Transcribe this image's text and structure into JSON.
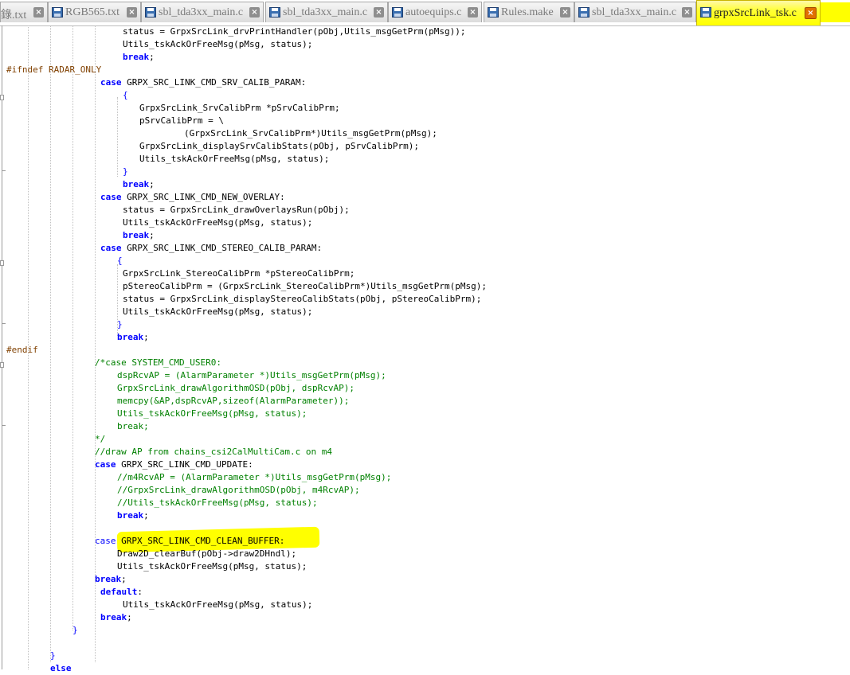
{
  "tabs": [
    {
      "label": "錄.txt",
      "icon": "",
      "active": false
    },
    {
      "label": "RGB565.txt",
      "icon": "floppy-disk-icon",
      "active": false
    },
    {
      "label": "sbl_tda3xx_main.c",
      "icon": "floppy-disk-icon",
      "active": false
    },
    {
      "label": "sbl_tda3xx_main.c",
      "icon": "floppy-disk-icon",
      "active": false
    },
    {
      "label": "autoequips.c",
      "icon": "floppy-disk-icon",
      "active": false
    },
    {
      "label": "Rules.make",
      "icon": "floppy-disk-icon",
      "active": false
    },
    {
      "label": "sbl_tda3xx_main.c",
      "icon": "floppy-disk-icon",
      "active": false
    },
    {
      "label": "grpxSrcLink_tsk.c",
      "icon": "floppy-disk-icon",
      "active": true
    }
  ],
  "close_glyph": "×",
  "colors": {
    "keyword": "#0000ff",
    "preprocessor": "#804000",
    "comment": "#008000",
    "highlight": "#ffff00",
    "active_tab": "#ffff00"
  },
  "code_lines": [
    {
      "spans": [
        {
          "t": "status = GrpxSrcLink_drvPrintHandler(pObj,Utils_msgGetPrm(pMsg));",
          "c": ""
        }
      ]
    },
    {
      "spans": [
        {
          "t": "Utils_tskAckOrFreeMsg(pMsg, status);",
          "c": ""
        }
      ]
    },
    {
      "spans": [
        {
          "t": "break",
          "c": "kw"
        },
        {
          "t": ";",
          "c": ""
        }
      ]
    },
    {
      "spans": [
        {
          "t": "#ifndef RADAR_ONLY",
          "c": "pp"
        }
      ]
    },
    {
      "spans": [
        {
          "t": "case",
          "c": "kw"
        },
        {
          "t": " GRPX_SRC_LINK_CMD_SRV_CALIB_PARAM:",
          "c": ""
        }
      ]
    },
    {
      "spans": [
        {
          "t": "{",
          "c": "ckw"
        }
      ]
    },
    {
      "spans": [
        {
          "t": "GrpxSrcLink_SrvCalibPrm *pSrvCalibPrm;",
          "c": ""
        }
      ]
    },
    {
      "spans": [
        {
          "t": "pSrvCalibPrm = \\",
          "c": ""
        }
      ]
    },
    {
      "spans": [
        {
          "t": "(GrpxSrcLink_SrvCalibPrm*)Utils_msgGetPrm(pMsg);",
          "c": ""
        }
      ]
    },
    {
      "spans": [
        {
          "t": "GrpxSrcLink_displaySrvCalibStats(pObj, pSrvCalibPrm);",
          "c": ""
        }
      ]
    },
    {
      "spans": [
        {
          "t": "Utils_tskAckOrFreeMsg(pMsg, status);",
          "c": ""
        }
      ]
    },
    {
      "spans": [
        {
          "t": "}",
          "c": "ckw"
        }
      ]
    },
    {
      "spans": [
        {
          "t": "break",
          "c": "kw"
        },
        {
          "t": ";",
          "c": ""
        }
      ]
    },
    {
      "spans": [
        {
          "t": "case",
          "c": "kw"
        },
        {
          "t": " GRPX_SRC_LINK_CMD_NEW_OVERLAY:",
          "c": ""
        }
      ]
    },
    {
      "spans": [
        {
          "t": "status = GrpxSrcLink_drawOverlaysRun(pObj);",
          "c": ""
        }
      ]
    },
    {
      "spans": [
        {
          "t": "Utils_tskAckOrFreeMsg(pMsg, status);",
          "c": ""
        }
      ]
    },
    {
      "spans": [
        {
          "t": "break",
          "c": "kw"
        },
        {
          "t": ";",
          "c": ""
        }
      ]
    },
    {
      "spans": [
        {
          "t": "case",
          "c": "kw"
        },
        {
          "t": " GRPX_SRC_LINK_CMD_STEREO_CALIB_PARAM:",
          "c": ""
        }
      ]
    },
    {
      "spans": [
        {
          "t": "{",
          "c": "ckw"
        }
      ]
    },
    {
      "spans": [
        {
          "t": "GrpxSrcLink_StereoCalibPrm *pStereoCalibPrm;",
          "c": ""
        }
      ]
    },
    {
      "spans": [
        {
          "t": "pStereoCalibPrm = (GrpxSrcLink_StereoCalibPrm*)Utils_msgGetPrm(pMsg);",
          "c": ""
        }
      ]
    },
    {
      "spans": [
        {
          "t": "status = GrpxSrcLink_displayStereoCalibStats(pObj, pStereoCalibPrm);",
          "c": ""
        }
      ]
    },
    {
      "spans": [
        {
          "t": "Utils_tskAckOrFreeMsg(pMsg, status);",
          "c": ""
        }
      ]
    },
    {
      "spans": [
        {
          "t": "}",
          "c": "ckw"
        }
      ]
    },
    {
      "spans": [
        {
          "t": "break",
          "c": "kw"
        },
        {
          "t": ";",
          "c": ""
        }
      ]
    },
    {
      "spans": [
        {
          "t": "#endif",
          "c": "pp"
        }
      ]
    },
    {
      "spans": [
        {
          "t": "/*case SYSTEM_CMD_USER0:",
          "c": "cm"
        }
      ]
    },
    {
      "spans": [
        {
          "t": "dspRcvAP = (AlarmParameter *)Utils_msgGetPrm(pMsg);",
          "c": "cm"
        }
      ]
    },
    {
      "spans": [
        {
          "t": "GrpxSrcLink_drawAlgorithmOSD(pObj, dspRcvAP);",
          "c": "cm"
        }
      ]
    },
    {
      "spans": [
        {
          "t": "memcpy(&AP,dspRcvAP,sizeof(AlarmParameter));",
          "c": "cm"
        }
      ]
    },
    {
      "spans": [
        {
          "t": "Utils_tskAckOrFreeMsg(pMsg, status);",
          "c": "cm"
        }
      ]
    },
    {
      "spans": [
        {
          "t": "break;",
          "c": "cm"
        }
      ]
    },
    {
      "spans": [
        {
          "t": "*/",
          "c": "cm"
        }
      ]
    },
    {
      "spans": [
        {
          "t": "//draw AP from chains_csi2CalMultiCam.c on m4",
          "c": "cm"
        }
      ]
    },
    {
      "spans": [
        {
          "t": "case",
          "c": "kw"
        },
        {
          "t": " GRPX_SRC_LINK_CMD_UPDATE:",
          "c": ""
        }
      ]
    },
    {
      "spans": [
        {
          "t": "//m4RcvAP = (AlarmParameter *)Utils_msgGetPrm(pMsg);",
          "c": "cm"
        }
      ]
    },
    {
      "spans": [
        {
          "t": "//GrpxSrcLink_drawAlgorithmOSD(pObj, m4RcvAP);",
          "c": "cm"
        }
      ]
    },
    {
      "spans": [
        {
          "t": "//Utils_tskAckOrFreeMsg(pMsg, status);",
          "c": "cm"
        }
      ]
    },
    {
      "spans": [
        {
          "t": "break",
          "c": "kw"
        },
        {
          "t": ";",
          "c": ""
        }
      ]
    },
    {
      "spans": []
    },
    {
      "spans": [
        {
          "t": "case",
          "c": "ckw"
        },
        {
          "t": " GRPX_SRC_LINK_CMD_CLEAN_BUFFER:",
          "c": ""
        }
      ]
    },
    {
      "spans": [
        {
          "t": "Draw2D_clearBuf(pObj->draw2DHndl);",
          "c": ""
        }
      ]
    },
    {
      "spans": [
        {
          "t": "Utils_tskAckOrFreeMsg(pMsg, status);",
          "c": ""
        }
      ]
    },
    {
      "spans": [
        {
          "t": "break",
          "c": "kw"
        },
        {
          "t": ";",
          "c": ""
        }
      ]
    },
    {
      "spans": [
        {
          "t": "default",
          "c": "kw"
        },
        {
          "t": ":",
          "c": ""
        }
      ]
    },
    {
      "spans": [
        {
          "t": "Utils_tskAckOrFreeMsg(pMsg, status);",
          "c": ""
        }
      ]
    },
    {
      "spans": [
        {
          "t": "break",
          "c": "kw"
        },
        {
          "t": ";",
          "c": ""
        }
      ]
    },
    {
      "spans": [
        {
          "t": "}",
          "c": "ckw"
        }
      ]
    },
    {
      "spans": []
    },
    {
      "spans": [
        {
          "t": "}",
          "c": "ckw"
        }
      ]
    },
    {
      "spans": [
        {
          "t": "else",
          "c": "kw"
        }
      ]
    }
  ]
}
